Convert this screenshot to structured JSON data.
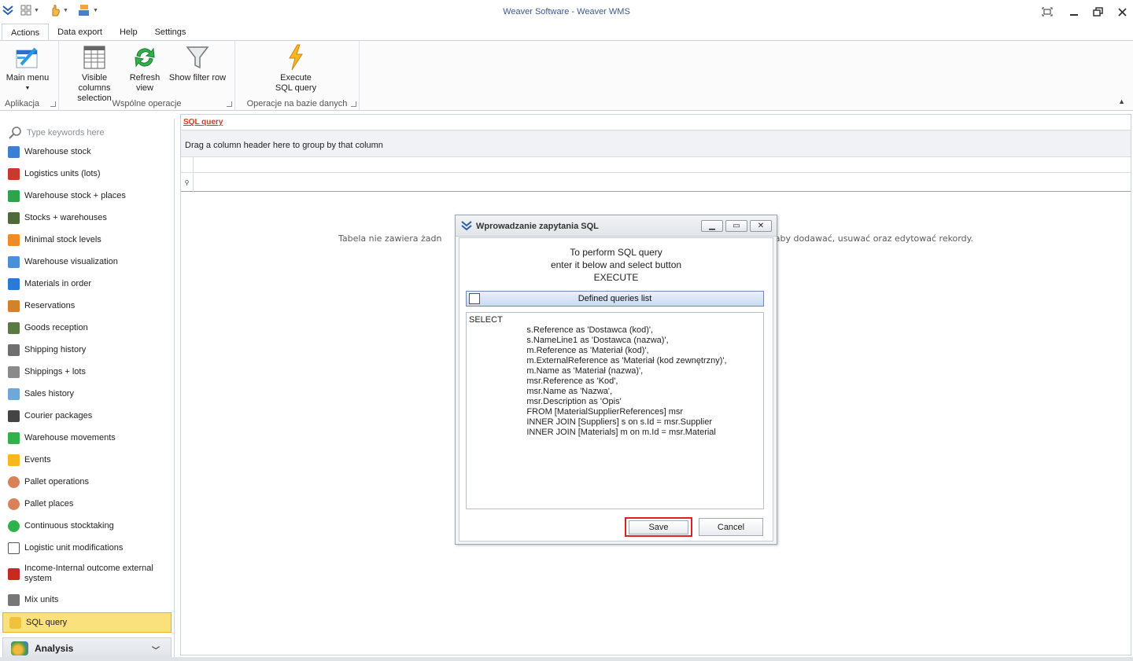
{
  "window": {
    "title": "Weaver Software - Weaver WMS"
  },
  "ribbon": {
    "tabs": [
      "Actions",
      "Data export",
      "Help",
      "Settings"
    ],
    "groups": {
      "aplikacja": {
        "label": "Aplikacja",
        "main_menu": "Main menu"
      },
      "wspolne": {
        "label": "Wspólne operacje",
        "visible_columns_1": "Visible columns",
        "visible_columns_2": "selection",
        "refresh_1": "Refresh",
        "refresh_2": "view",
        "show_filter": "Show filter row"
      },
      "operacje": {
        "label": "Operacje na bazie danych",
        "execute_1": "Execute",
        "execute_2": "SQL query"
      }
    }
  },
  "nav": {
    "search_placeholder": "Type keywords here",
    "items": [
      "Warehouse stock",
      "Logistics units (lots)",
      "Warehouse stock + places",
      "Stocks + warehouses",
      "Minimal stock levels",
      "Warehouse visualization",
      "Materials in order",
      "Reservations",
      "Goods reception",
      "Shipping history",
      "Shippings + lots",
      "Sales history",
      "Courier packages",
      "Warehouse movements",
      "Events",
      "Pallet operations",
      "Pallet places",
      "Continuous stocktaking",
      "Logistic unit modifications",
      "Income-Internal outcome external system",
      "Mix units"
    ],
    "selected": "SQL query",
    "analysis": "Analysis"
  },
  "main": {
    "title": "SQL query",
    "groupbar": "Drag a column header here to group by that column",
    "empty_left": "Tabela nie zawiera żadn",
    "empty_right": "e' aby dodawać, usuwać oraz edytować rekordy."
  },
  "dialog": {
    "title": "Wprowadzanie zapytania SQL",
    "instruction_1": "To perform SQL query",
    "instruction_2": "enter it below and select button",
    "instruction_3": "EXECUTE",
    "defined_queries": "Defined queries list",
    "sql": "SELECT\n                        s.Reference as 'Dostawca (kod)',\n                        s.NameLine1 as 'Dostawca (nazwa)',\n                        m.Reference as 'Materiał (kod)',\n                        m.ExternalReference as 'Materiał (kod zewnętrzny)',\n                        m.Name as 'Materiał (nazwa)',\n                        msr.Reference as 'Kod',\n                        msr.Name as 'Nazwa',\n                        msr.Description as 'Opis'\n                        FROM [MaterialSupplierReferences] msr\n                        INNER JOIN [Suppliers] s on s.Id = msr.Supplier\n                        INNER JOIN [Materials] m on m.Id = msr.Material",
    "save": "Save",
    "cancel": "Cancel"
  },
  "colors": {
    "accent": "#fbe17b",
    "title_text": "#3a5a8c",
    "link_red": "#d8391b",
    "highlight_red": "#e02020"
  }
}
